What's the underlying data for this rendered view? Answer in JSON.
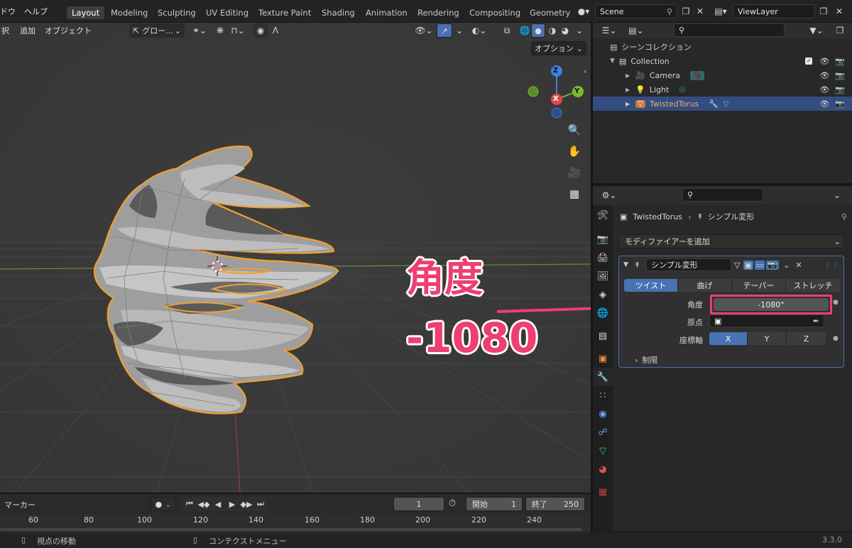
{
  "topbar": {
    "menus": [
      "ドウ",
      "ヘルプ"
    ],
    "workspaces": [
      "Layout",
      "Modeling",
      "Sculpting",
      "UV Editing",
      "Texture Paint",
      "Shading",
      "Animation",
      "Rendering",
      "Compositing",
      "Geometry"
    ],
    "active_workspace": "Layout",
    "scene": "Scene",
    "view_layer": "ViewLayer"
  },
  "viewport": {
    "menus": [
      "択",
      "追加",
      "オブジェクト"
    ],
    "transform_orientation": "グロー...",
    "options_label": "オプション",
    "gizmo": {
      "z": "Z",
      "x": "X",
      "y": "Y"
    }
  },
  "annotation": {
    "label": "角度",
    "value": "-1080",
    "color": "#ee3e72"
  },
  "outliner": {
    "scene_collection": "シーンコレクション",
    "rows": [
      {
        "name": "Collection",
        "level": 1
      },
      {
        "name": "Camera",
        "level": 2
      },
      {
        "name": "Light",
        "level": 2
      },
      {
        "name": "TwistedTorus",
        "level": 2,
        "selected": true
      }
    ]
  },
  "properties": {
    "breadcrumb_object": "TwistedTorus",
    "breadcrumb_modifier": "シンプル変形",
    "add_modifier": "モディファイアーを追加",
    "modifier_name": "シンプル変形",
    "modes": [
      "ツイスト",
      "曲げ",
      "テーパー",
      "ストレッチ"
    ],
    "active_mode": "ツイスト",
    "angle_label": "角度",
    "angle_value": "-1080°",
    "origin_label": "原点",
    "axis_label": "座標軸",
    "axes": [
      "X",
      "Y",
      "Z"
    ],
    "active_axis": "X",
    "limits_label": "制限"
  },
  "timeline": {
    "marker_label": "マーカー",
    "current_frame": "1",
    "start_label": "開始",
    "start_value": "1",
    "end_label": "終了",
    "end_value": "250",
    "ticks": [
      "60",
      "80",
      "100",
      "120",
      "140",
      "160",
      "180",
      "200",
      "220",
      "240"
    ]
  },
  "statusbar": {
    "left": "視点の移動",
    "middle": "コンテクストメニュー",
    "version": "3.3.0"
  },
  "colors": {
    "accent": "#4772b3",
    "selection_outline": "#f0a030",
    "annotation": "#ee3e72"
  }
}
